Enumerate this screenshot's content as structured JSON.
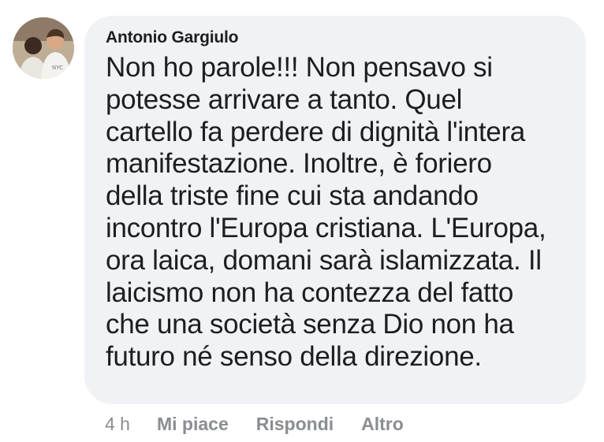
{
  "comment": {
    "author": "Antonio Gargiulo",
    "lines": [
      "Non ho parole!!! Non pensavo si",
      "potesse arrivare a tanto. Quel",
      "cartello fa perdere di dignità l'intera",
      "manifestazione. Inoltre, è foriero",
      "della triste fine cui sta andando",
      "incontro l'Europa cristiana. L'Europa,",
      "ora laica, domani sarà islamizzata. Il",
      "laicismo non ha contezza del fatto",
      "che una società senza Dio non ha",
      "futuro né senso della direzione."
    ],
    "time": "4 h",
    "actions": {
      "like": "Mi piace",
      "reply": "Rispondi",
      "more": "Altro"
    }
  },
  "colors": {
    "bubble_background": "#f0f2f5",
    "text": "#1c1e21",
    "meta_text": "#8a8d91"
  }
}
